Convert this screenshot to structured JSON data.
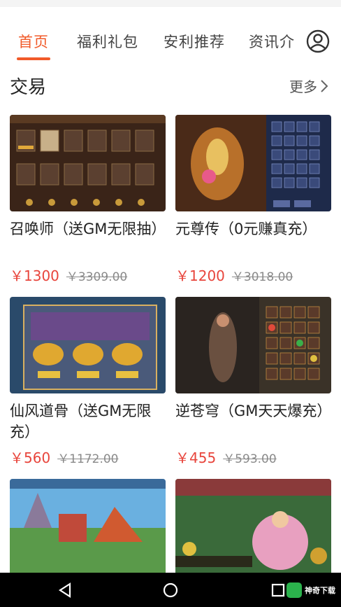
{
  "tabs": [
    {
      "label": "首页",
      "active": true
    },
    {
      "label": "福利礼包",
      "active": false
    },
    {
      "label": "安利推荐",
      "active": false
    },
    {
      "label": "资讯介",
      "active": false
    }
  ],
  "header": {
    "avatar_icon": "user-circle-icon"
  },
  "section": {
    "title": "交易",
    "more_label": "更多"
  },
  "cards": [
    {
      "title": "召唤师（送GM无限抽）",
      "price": "￥1300",
      "original_price": "￥3309.00"
    },
    {
      "title": "元尊传（0元赚真充）",
      "price": "￥1200",
      "original_price": "￥3018.00"
    },
    {
      "title": "仙风道骨（送GM无限充）",
      "price": "￥560",
      "original_price": "￥1172.00"
    },
    {
      "title": "逆苍穹（GM天天爆充）",
      "price": "￥455",
      "original_price": "￥593.00"
    },
    {
      "title": "",
      "price": "",
      "original_price": ""
    },
    {
      "title": "",
      "price": "",
      "original_price": ""
    }
  ],
  "navbar": {
    "back_icon": "back-triangle-icon",
    "home_icon": "home-circle-icon",
    "recent_icon": "recent-square-icon"
  },
  "watermark": {
    "text": "神奇下载"
  },
  "colors": {
    "accent": "#f15a29",
    "price": "#e8453c"
  }
}
